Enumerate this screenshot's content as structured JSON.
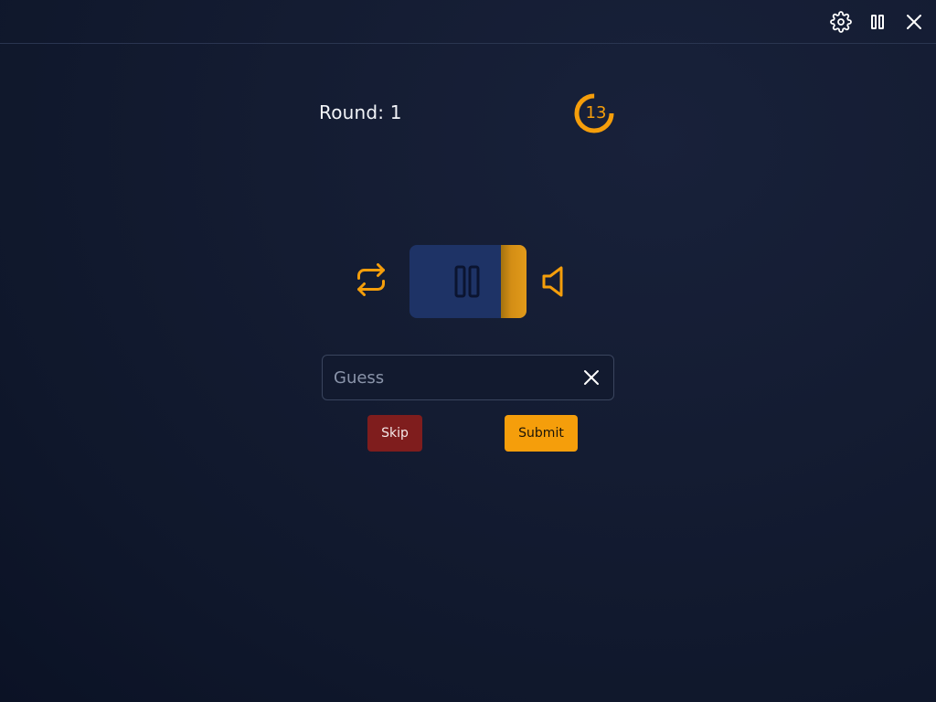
{
  "header": {
    "icons": [
      "gear-icon",
      "pause-icon",
      "close-icon"
    ]
  },
  "game": {
    "round_label": "Round: 1",
    "timer_value": "13",
    "timer_fraction_remaining": 0.75
  },
  "player": {
    "state_icon": "pause-icon",
    "progress_fraction": 0.22,
    "repeat_icon": "repeat-icon",
    "volume_icon": "volume-icon"
  },
  "guess": {
    "placeholder": "Guess",
    "value": ""
  },
  "actions": {
    "skip_label": "Skip",
    "submit_label": "Submit"
  },
  "colors": {
    "accent": "#f59e0b",
    "skip": "#7f1d1d",
    "player_bg": "#1e3366",
    "background": "#141c32"
  }
}
